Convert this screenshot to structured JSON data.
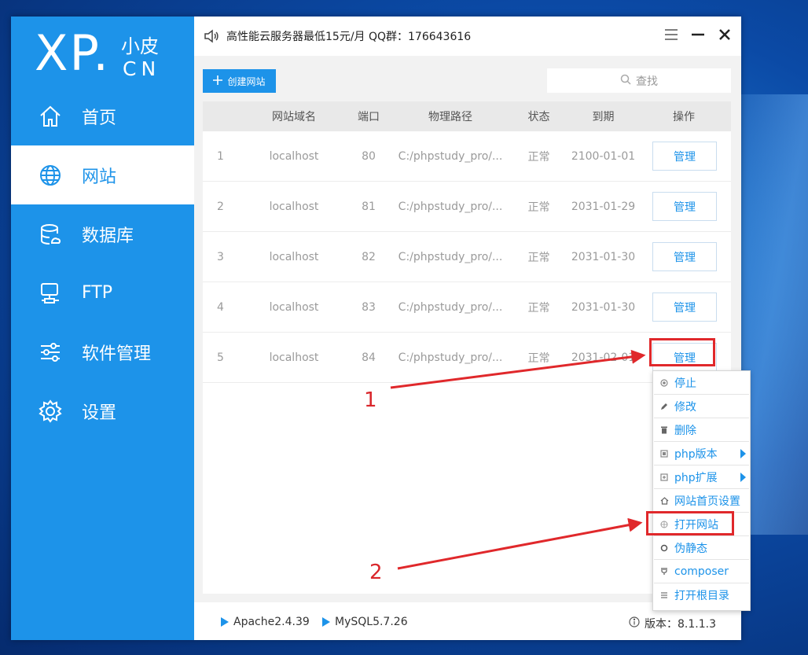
{
  "logo": {
    "main": "XP",
    "dot": ".",
    "sub_top": "小皮",
    "sub_bottom": "CN"
  },
  "nav": [
    {
      "label": "首页",
      "icon": "home-icon"
    },
    {
      "label": "网站",
      "icon": "globe-icon",
      "active": true
    },
    {
      "label": "数据库",
      "icon": "database-icon"
    },
    {
      "label": "FTP",
      "icon": "ftp-icon"
    },
    {
      "label": "软件管理",
      "icon": "sliders-icon"
    },
    {
      "label": "设置",
      "icon": "gear-icon"
    }
  ],
  "topbar": {
    "notice": "高性能云服务器最低15元/月  QQ群：176643616"
  },
  "toolbar": {
    "create_label": "创建网站",
    "search_placeholder": "查找"
  },
  "table": {
    "headers": [
      "网站域名",
      "端口",
      "物理路径",
      "状态",
      "到期",
      "操作"
    ],
    "rows": [
      {
        "index": "1",
        "domain": "localhost",
        "port": "80",
        "path": "C:/phpstudy_pro/...",
        "status": "正常",
        "expiry": "2100-01-01",
        "action": "管理"
      },
      {
        "index": "2",
        "domain": "localhost",
        "port": "81",
        "path": "C:/phpstudy_pro/...",
        "status": "正常",
        "expiry": "2031-01-29",
        "action": "管理"
      },
      {
        "index": "3",
        "domain": "localhost",
        "port": "82",
        "path": "C:/phpstudy_pro/...",
        "status": "正常",
        "expiry": "2031-01-30",
        "action": "管理"
      },
      {
        "index": "4",
        "domain": "localhost",
        "port": "83",
        "path": "C:/phpstudy_pro/...",
        "status": "正常",
        "expiry": "2031-01-30",
        "action": "管理"
      },
      {
        "index": "5",
        "domain": "localhost",
        "port": "84",
        "path": "C:/phpstudy_pro/...",
        "status": "正常",
        "expiry": "2031-02-01",
        "action": "管理"
      }
    ]
  },
  "context_menu": [
    {
      "label": "停止",
      "icon": "stop-icon"
    },
    {
      "label": "修改",
      "icon": "edit-icon"
    },
    {
      "label": "删除",
      "icon": "trash-icon"
    },
    {
      "label": "php版本",
      "icon": "php-version-icon",
      "submenu": true
    },
    {
      "label": "php扩展",
      "icon": "php-extension-icon",
      "submenu": true
    },
    {
      "label": "网站首页设置",
      "icon": "homepage-icon"
    },
    {
      "label": "打开网站",
      "icon": "open-site-icon"
    },
    {
      "label": "伪静态",
      "icon": "rewrite-icon"
    },
    {
      "label": "composer",
      "icon": "composer-icon"
    },
    {
      "label": "打开根目录",
      "icon": "folder-list-icon"
    }
  ],
  "footer": {
    "apache": "Apache2.4.39",
    "mysql": "MySQL5.7.26",
    "version": "版本：8.1.1.3"
  },
  "annotations": {
    "step1": "1",
    "step2": "2"
  },
  "colors": {
    "accent": "#1d93e9",
    "highlight": "#e0282b"
  }
}
